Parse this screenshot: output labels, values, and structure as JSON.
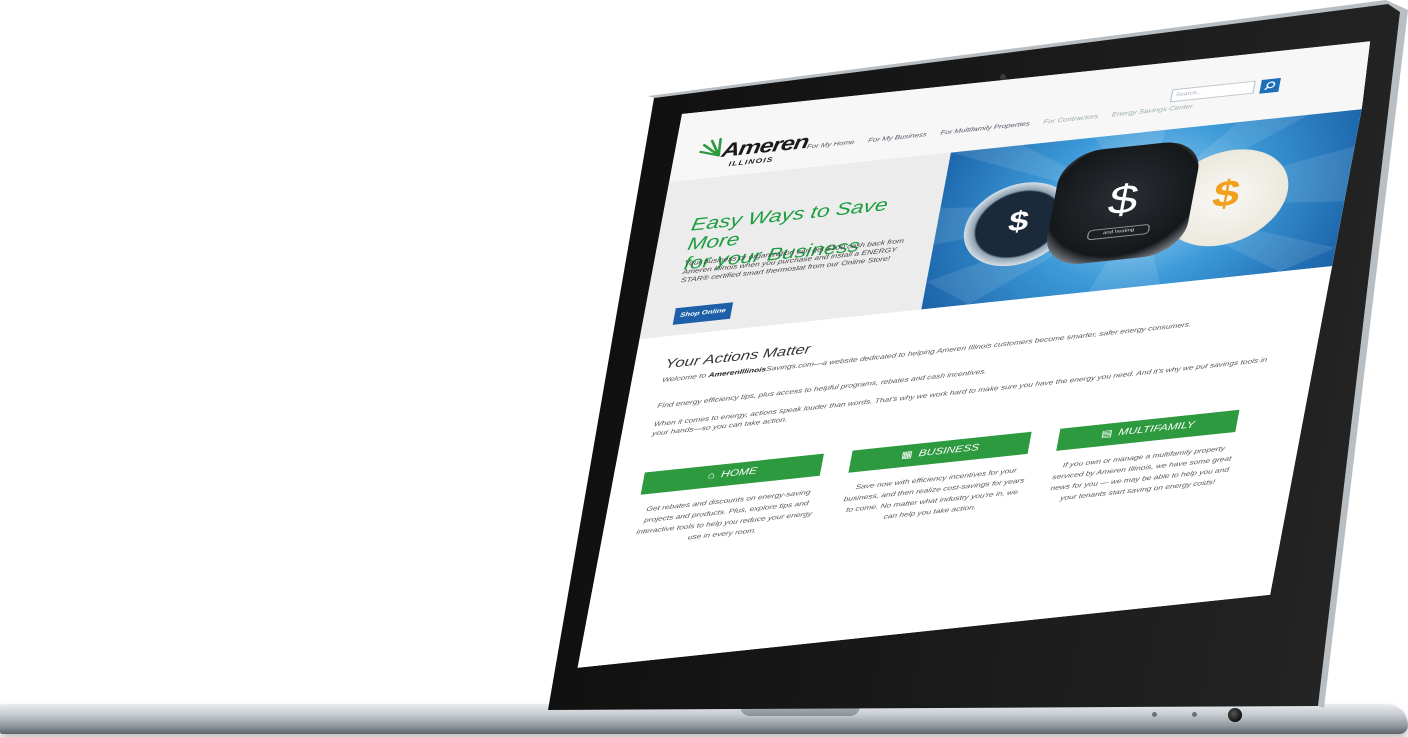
{
  "site": {
    "logo": {
      "name": "Ameren",
      "sub": "ILLINOIS"
    },
    "nav": [
      "For My Home",
      "For My Business",
      "For Multifamily Properties",
      "For Contractors",
      "Energy Savings Center"
    ],
    "search": {
      "placeholder": "Search..."
    }
  },
  "hero": {
    "title_line1": "Easy Ways to Save More",
    "title_line2": "for your Business",
    "text": "Your business or organization can get $100 cash back from Ameren Illinois when you purchase and install a ENERGY STAR® certified smart thermostat from our Online Store!",
    "button": "Shop Online",
    "image_icons": [
      "thermostat-icon",
      "thermostat-icon",
      "thermostat-icon"
    ],
    "thermostat_symbol": "$",
    "mode_label": "and heating"
  },
  "actions": {
    "title": "Your Actions Matter",
    "welcome_prefix": "Welcome to ",
    "welcome_site_bold": "AmerenIllinois",
    "welcome_site_rest": "Savings.com",
    "welcome_rest": "—a website dedicated to helping Ameren Illinois customers become smarter, safer energy consumers.",
    "p2": "Find energy efficiency tips, plus access to helpful programs, rebates and cash incentives.",
    "p3": "When it comes to energy, actions speak louder than words. That's why we work hard to make sure you have the energy you need. And it's why we put savings tools in your hands—so you can take action."
  },
  "cards": [
    {
      "label": "HOME",
      "icon": "home-icon",
      "text": "Get rebates and discounts on energy-saving projects and products. Plus, explore tips and interactive tools to help you reduce your energy use in every room."
    },
    {
      "label": "BUSINESS",
      "icon": "building-icon",
      "text": "Save now with efficiency incentives for your business, and then realize cost-savings for years to come. No matter what industry you're in, we can help you take action."
    },
    {
      "label": "MULTIFAMILY",
      "icon": "apartments-icon",
      "text": "If you own or manage a multifamily property serviced by Ameren Illinois, we have some great news for you — we may be able to help you and your tenants start saving on energy costs!"
    }
  ],
  "colors": {
    "green": "#2d9a3f",
    "blue": "#1d6fb8",
    "title_green": "#1a9e3f"
  }
}
